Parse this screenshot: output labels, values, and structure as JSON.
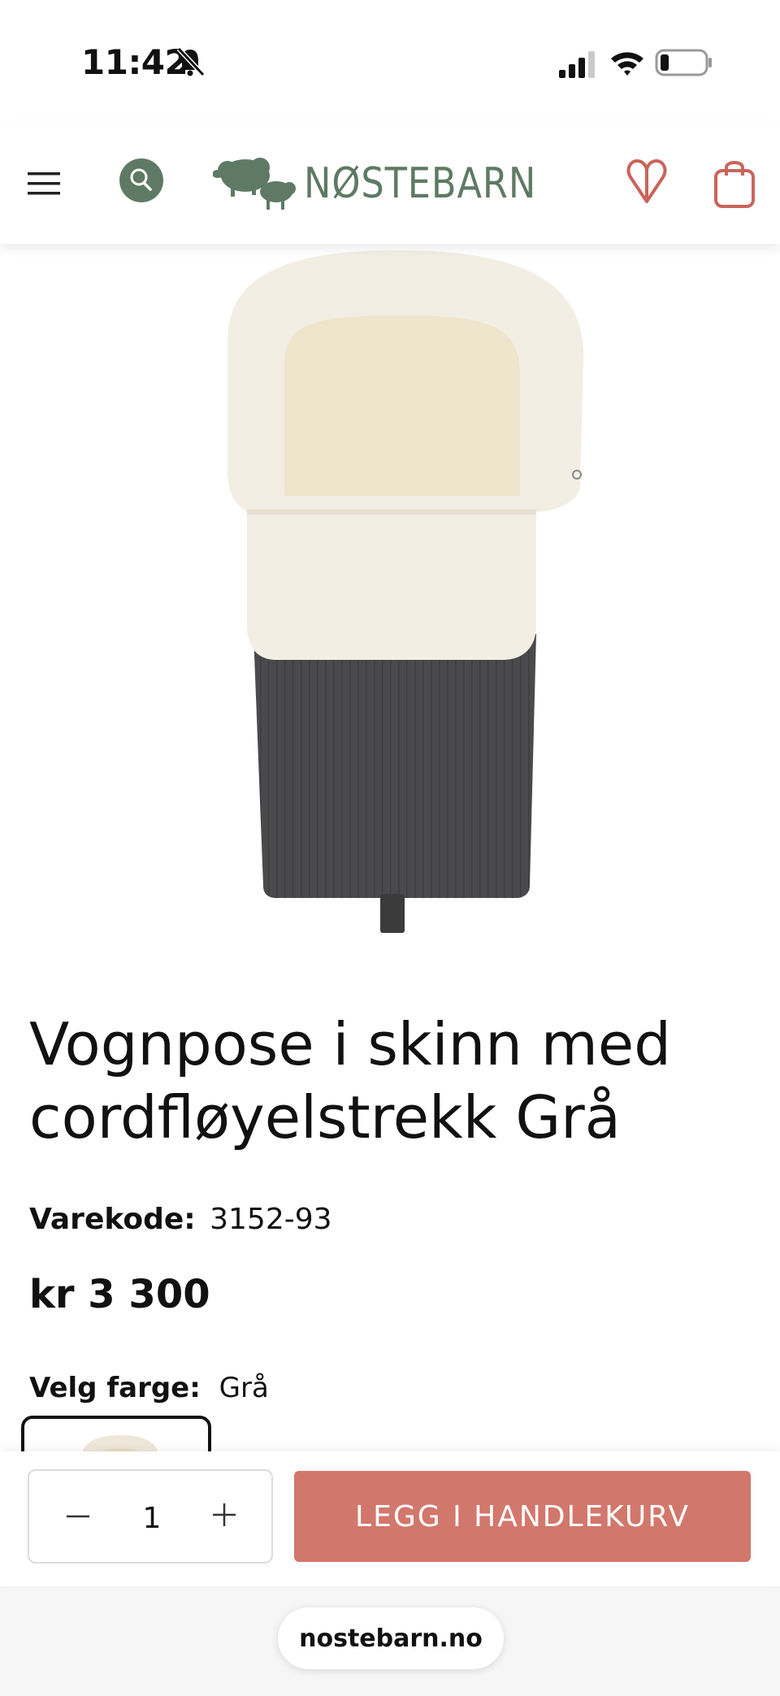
{
  "status_bar": {
    "time": "11:42"
  },
  "header": {
    "brand": "NØSTEBARN"
  },
  "product": {
    "title": "Vognpose i skinn med cordfløyelstrekk Grå",
    "sku_label": "Varekode:",
    "sku": "3152-93",
    "price": "kr 3 300",
    "color_label": "Velg farge:",
    "color_value": "Grå"
  },
  "cart_bar": {
    "quantity": "1",
    "add_to_cart": "LEGG I HANDLEKURV"
  },
  "browser": {
    "url": "nostebarn.no"
  },
  "colors": {
    "brand_green": "#5f7a64",
    "accent_rose": "#d2776c"
  }
}
